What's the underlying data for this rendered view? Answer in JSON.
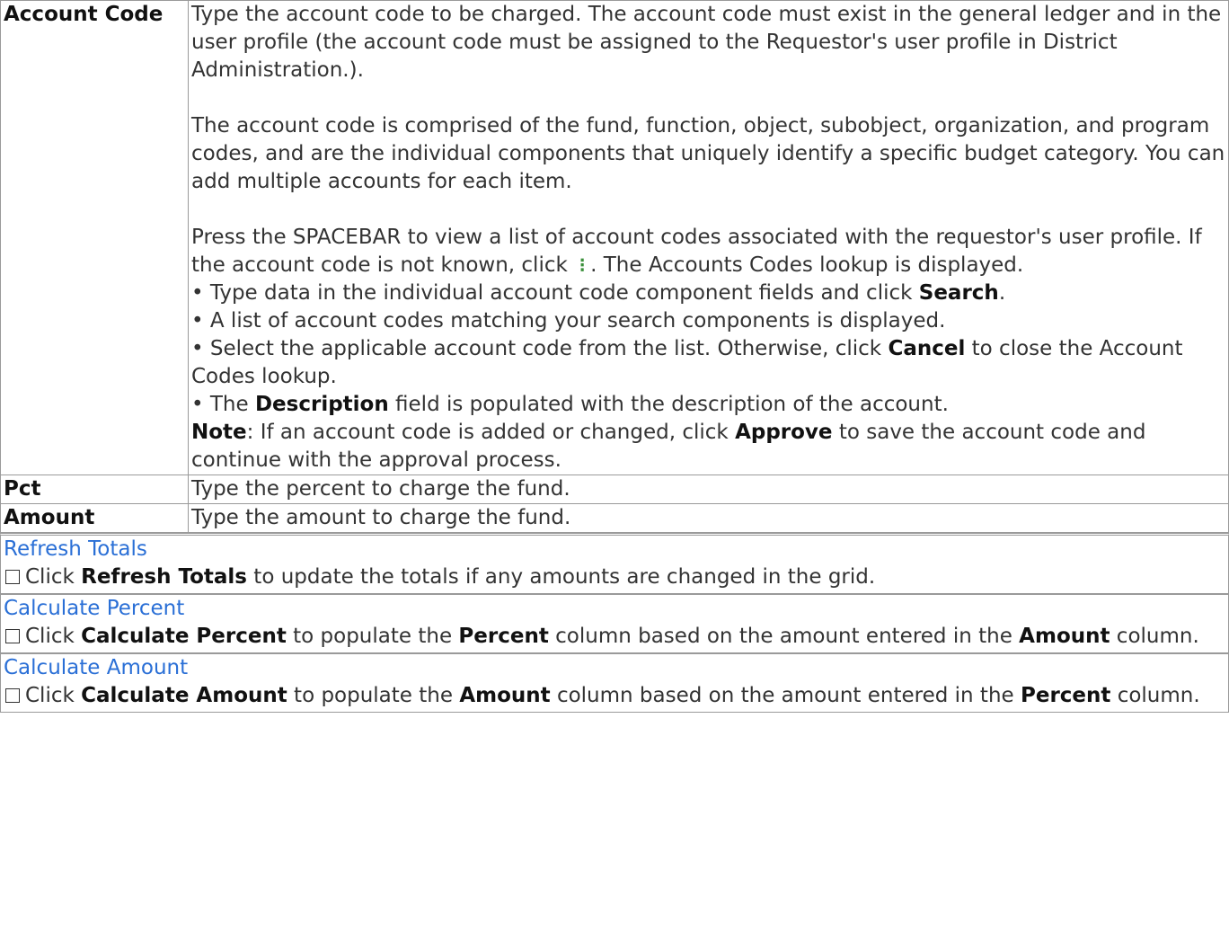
{
  "rows": {
    "account_code": {
      "label": "Account Code",
      "p1": "Type the account code to be charged. The account code must exist in the general ledger and in the user profile (the account code must be assigned to the Requestor's user profile in District Administration.).",
      "p2": "The account code is comprised of the fund, function, object, subobject, organization, and program codes, and are the individual components that uniquely identify a specific budget category. You can add multiple accounts for each item.",
      "p3_pre": "Press the SPACEBAR to view a list of account codes associated with the requestor's user profile. If the account code is not known, click",
      "p3_post": ". The Accounts Codes lookup is displayed.",
      "b1_pre": "• Type data in the individual account code component fields and click ",
      "b1_bold": "Search",
      "b1_post": ".",
      "b2": "• A list of account codes matching your search components is displayed.",
      "b3_pre": "• Select the applicable account code from the list. Otherwise, click ",
      "b3_bold": "Cancel",
      "b3_post": " to close the Account Codes lookup.",
      "b4_pre": "• The ",
      "b4_bold": "Description",
      "b4_post": " field is populated with the description of the account.",
      "note_label": "Note",
      "note_pre": ": If an account code is added or changed, click ",
      "note_bold": "Approve",
      "note_post": " to save the account code and continue with the approval process."
    },
    "pct": {
      "label": "Pct",
      "desc": "Type the percent to charge the fund."
    },
    "amount": {
      "label": "Amount",
      "desc": "Type the amount to charge the fund."
    }
  },
  "buttons": {
    "refresh": {
      "link": "Refresh Totals",
      "pre": "Click ",
      "bold": "Refresh Totals",
      "post": " to update the totals if any amounts are changed in the grid."
    },
    "calc_percent": {
      "link": "Calculate Percent",
      "pre": "Click ",
      "bold": "Calculate Percent",
      "mid": " to populate the ",
      "bold2": "Percent",
      "mid2": " column based on the amount entered in the ",
      "bold3": "Amount",
      "post": " column."
    },
    "calc_amount": {
      "link": "Calculate Amount",
      "pre": "Click ",
      "bold": "Calculate Amount",
      "mid": " to populate the ",
      "bold2": "Amount",
      "mid2": " column based on the amount entered in the ",
      "bold3": "Percent",
      "post": " column."
    }
  },
  "icons": {
    "lookup": "vertical-ellipsis-icon",
    "checkbox": "checkbox-icon"
  },
  "colors": {
    "link": "#2a6fd6",
    "lookup_icon": "#3a8f3a"
  }
}
